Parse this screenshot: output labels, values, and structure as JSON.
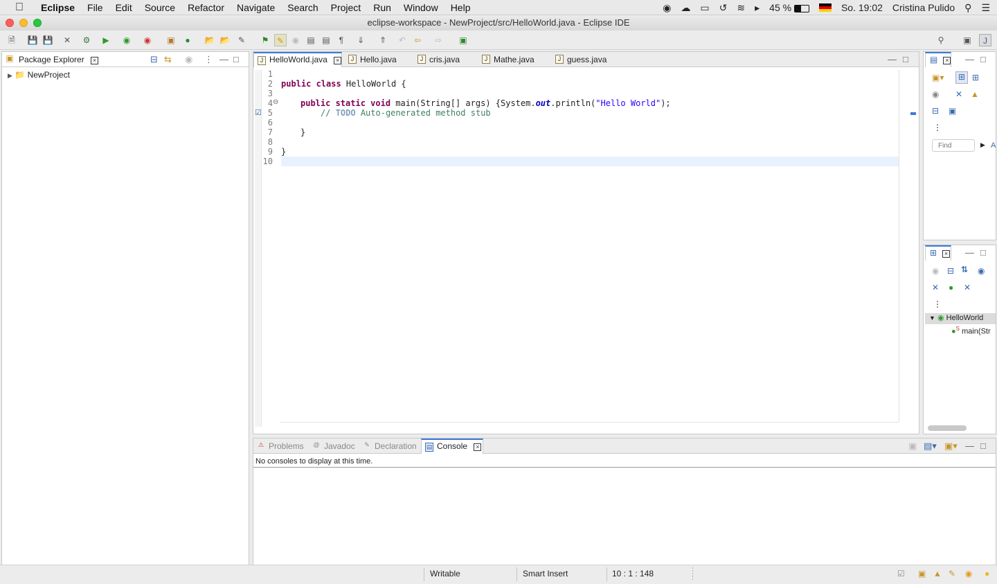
{
  "menubar": {
    "apple": "",
    "items": [
      "Eclipse",
      "File",
      "Edit",
      "Source",
      "Refactor",
      "Navigate",
      "Search",
      "Project",
      "Run",
      "Window",
      "Help"
    ],
    "battery": "45 %",
    "datetime": "So. 19:02",
    "user": "Cristina Pulido"
  },
  "window": {
    "title": "eclipse-workspace - NewProject/src/HelloWorld.java - Eclipse IDE"
  },
  "package_explorer": {
    "title": "Package Explorer",
    "tree": [
      {
        "label": "NewProject"
      }
    ]
  },
  "editor": {
    "tabs": [
      {
        "label": "HelloWorld.java",
        "active": true
      },
      {
        "label": "Hello.java",
        "active": false
      },
      {
        "label": "cris.java",
        "active": false
      },
      {
        "label": "Mathe.java",
        "active": false
      },
      {
        "label": "guess.java",
        "active": false
      }
    ],
    "line_numbers": [
      "1",
      "2",
      "3",
      "4",
      "5",
      "6",
      "7",
      "8",
      "9",
      "10"
    ],
    "code": {
      "l2_kw": "public class",
      "l2_rest": " HelloWorld {",
      "l4_kw": "public static void",
      "l4_a": " main(String[] args) {System.",
      "l4_field": "out",
      "l4_b": ".println(",
      "l4_str": "\"Hello World\"",
      "l4_c": ");",
      "l5_pre": "// ",
      "l5_todo": "TODO",
      "l5_rest": " Auto-generated method stub",
      "l7": "}",
      "l9": "}"
    }
  },
  "outline": {
    "find_placeholder": "Find",
    "find_link": "A",
    "class_name": "HelloWorld",
    "method_name": "main(Str",
    "static_marker": "S"
  },
  "bottom": {
    "tabs": [
      {
        "label": "Problems"
      },
      {
        "label": "Javadoc"
      },
      {
        "label": "Declaration"
      },
      {
        "label": "Console"
      }
    ],
    "console_message": "No consoles to display at this time."
  },
  "status": {
    "writable": "Writable",
    "insert_mode": "Smart Insert",
    "position": "10 : 1 : 148"
  },
  "colors": {
    "keyword": "#7f0055",
    "string": "#2a00ff",
    "comment": "#3f7f5f",
    "active_tab_border": "#3c78d8"
  }
}
